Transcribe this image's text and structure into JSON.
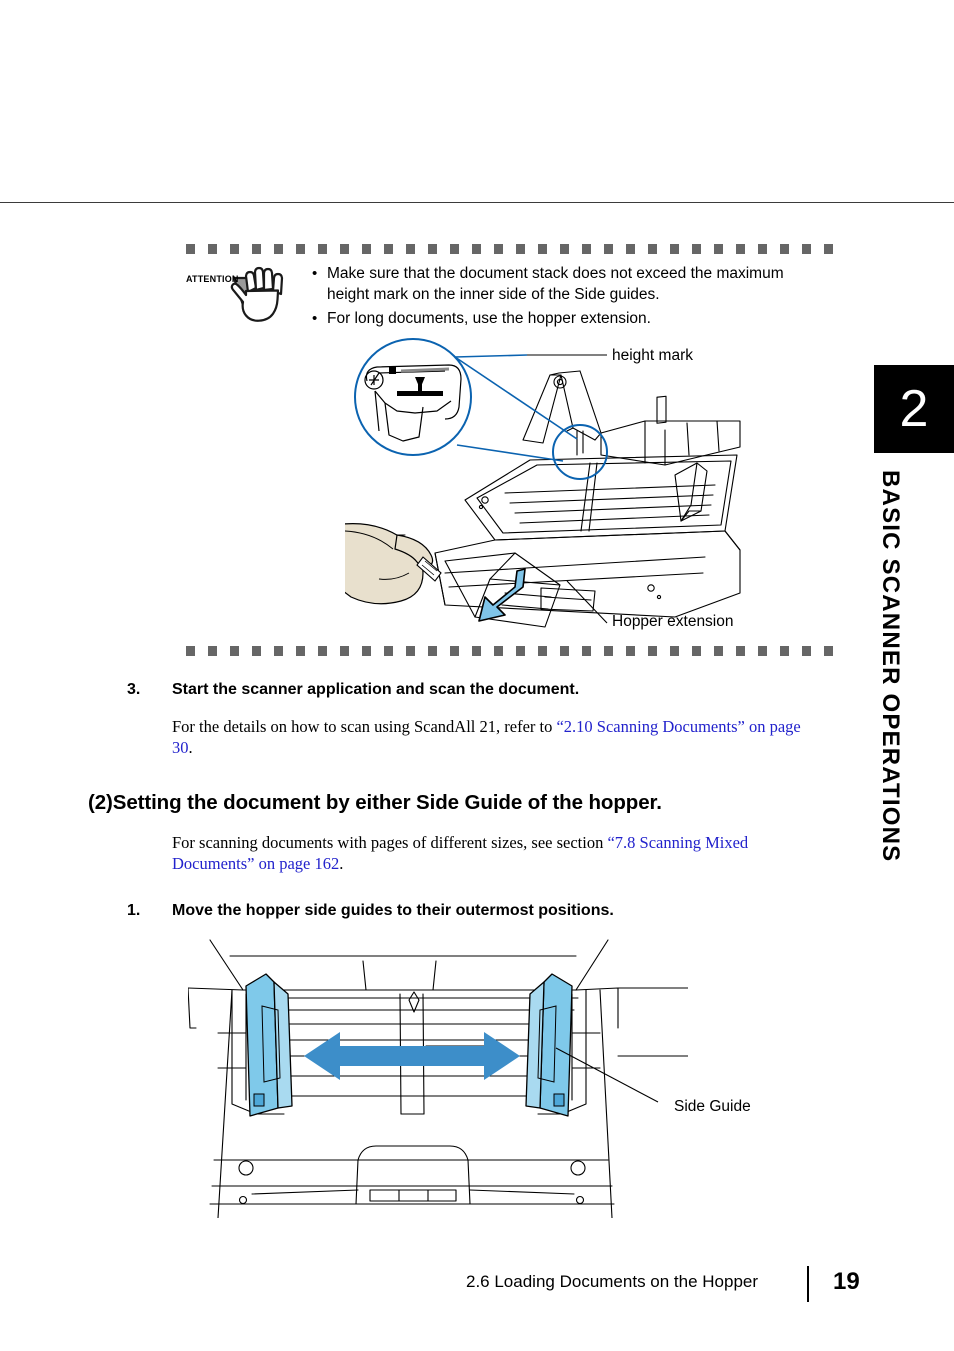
{
  "page": {
    "number": "19",
    "footer_section": "2.6 Loading Documents on the Hopper"
  },
  "chapter_tab": {
    "number": "2",
    "title": "BASIC SCANNER OPERATIONS"
  },
  "attention_box": {
    "label": "ATTENTION",
    "bullet_char": "•",
    "items": [
      "Make sure that the document stack does not exceed the maximum height mark on the inner side of the Side guides.",
      "For long documents, use the hopper extension."
    ]
  },
  "figure_top": {
    "callout_height_mark": "height mark",
    "callout_hopper_extension": "Hopper extension",
    "colors": {
      "magnifier_circle": "#0b63b0",
      "arrow_fill": "#7fc4e8",
      "hand_fill": "#e8e0cd",
      "outline": "#000000"
    }
  },
  "figure_bottom": {
    "callout_side_guide": "Side Guide",
    "colors": {
      "guide_fill": "#7fc9ea",
      "arrow_fill": "#3d8ec9",
      "outline": "#000000"
    }
  },
  "step3": {
    "number": "3.",
    "title": "Start the scanner application and scan the document.",
    "body_pre": "For the details on how to scan using ScandAll 21, refer to ",
    "body_link1": "“2.10 Scanning Documents” on page 30",
    "body_post": "."
  },
  "section2": {
    "heading": "(2)Setting the document by either Side Guide of the hopper.",
    "body_pre": "For scanning documents with pages of different sizes, see section ",
    "body_link1": "“7.8 Scanning Mixed Documents” on page 162",
    "body_post": "."
  },
  "step1": {
    "number": "1.",
    "title": "Move the hopper side guides to their outermost positions."
  }
}
